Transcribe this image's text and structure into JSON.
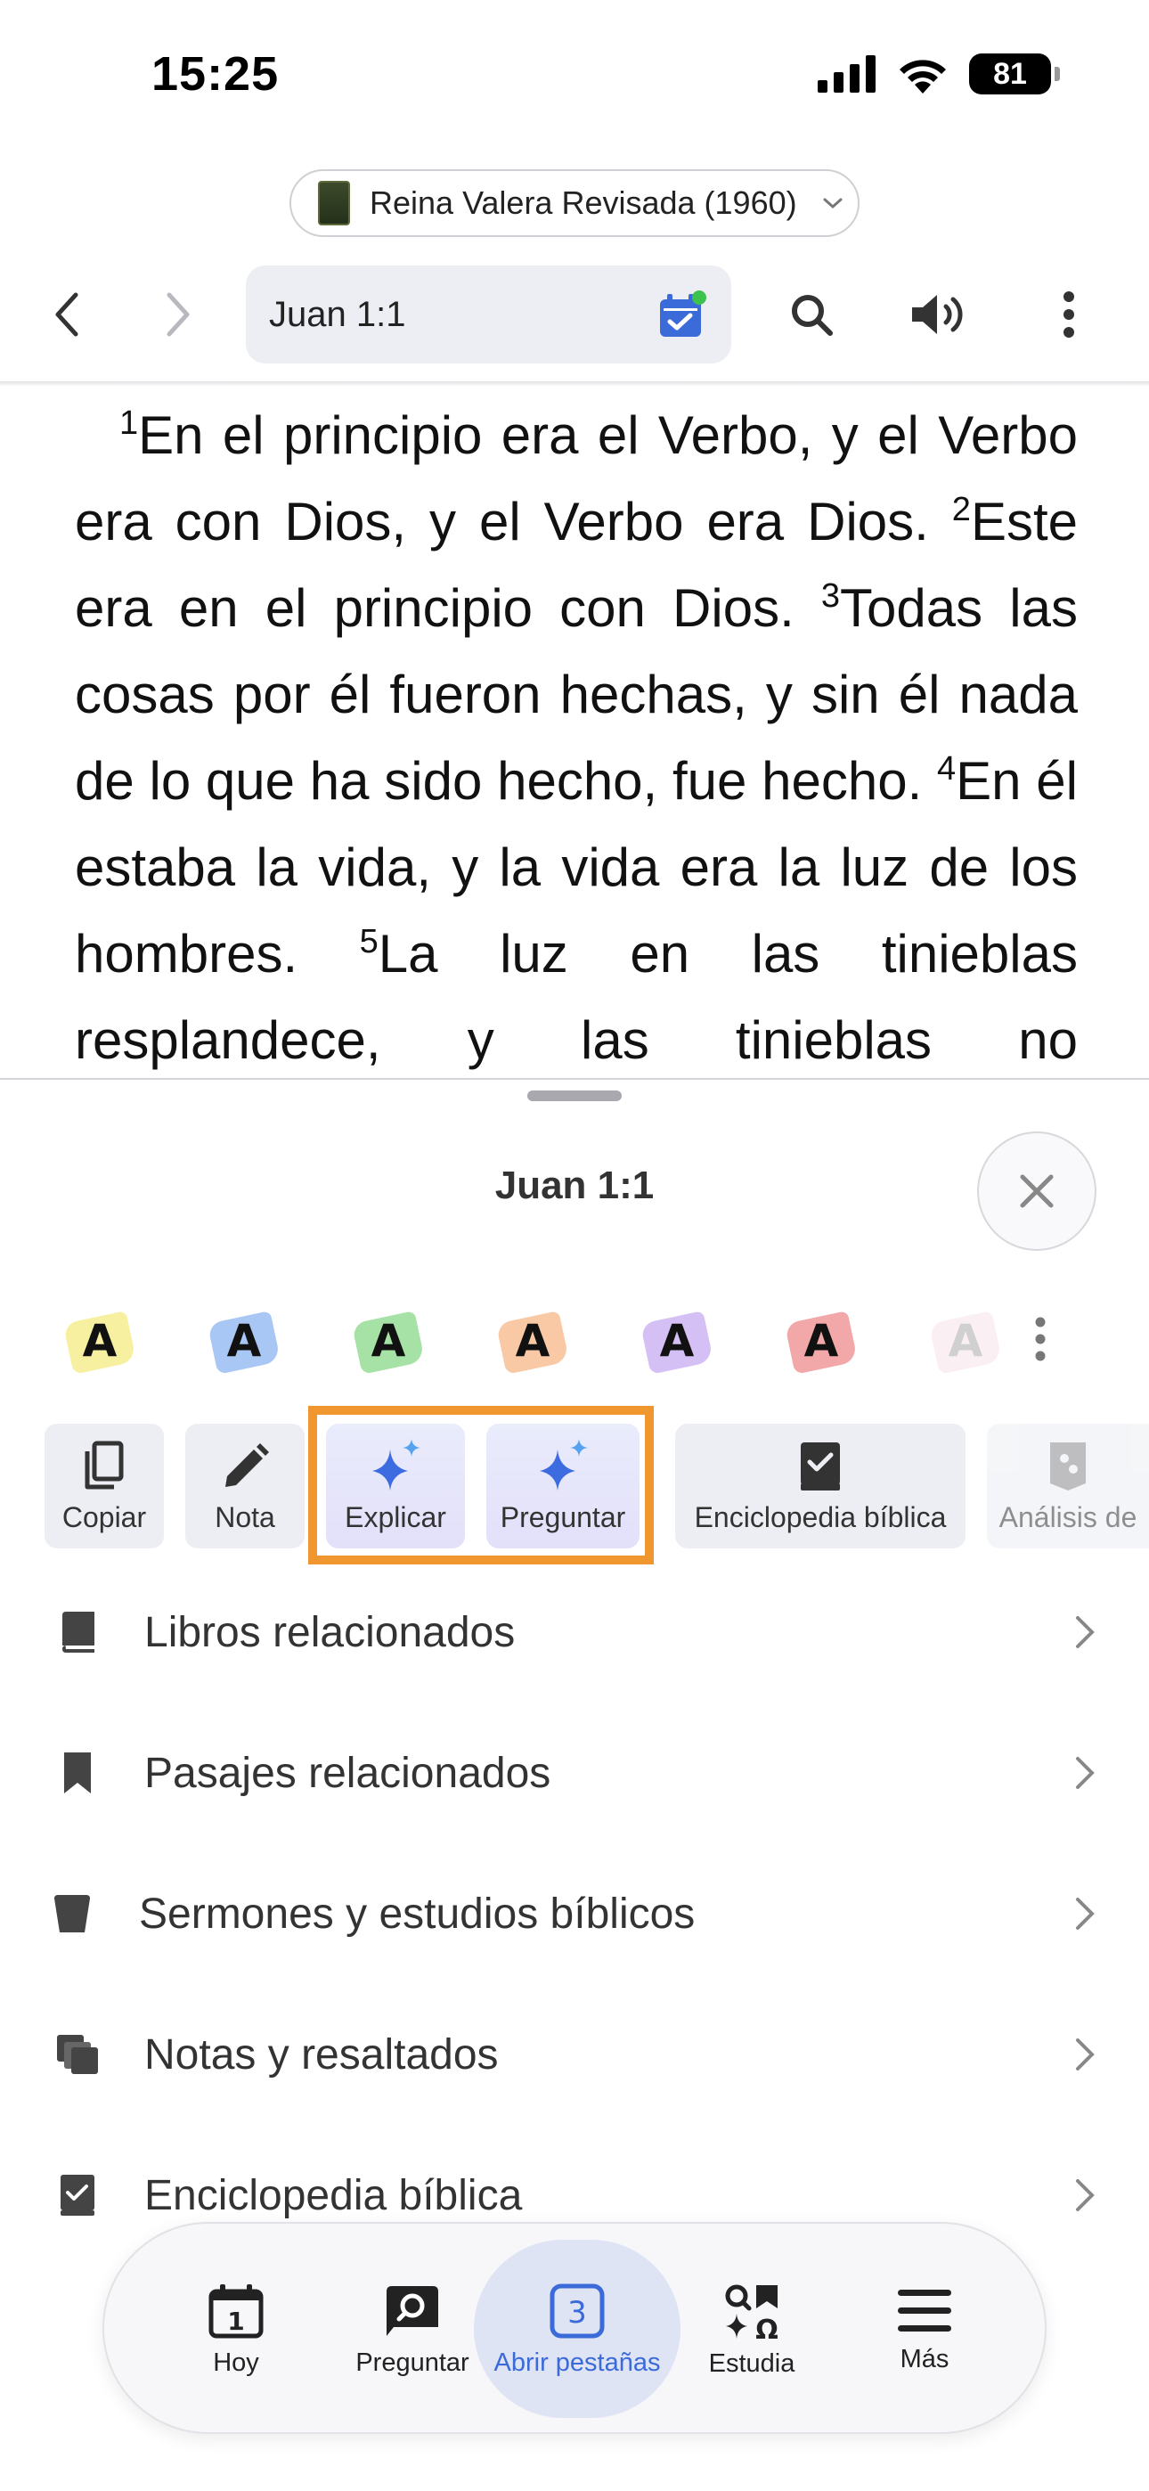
{
  "status_bar": {
    "time": "15:25",
    "battery": "81"
  },
  "version": {
    "label": "Reina Valera Revisada (1960)"
  },
  "nav": {
    "reference": "Juan 1:1"
  },
  "verses": [
    {
      "num": "1",
      "text": "En el principio era el Verbo, y el Verbo era con Dios, y el Verbo era Dios. "
    },
    {
      "num": "2",
      "text": "Este era en el principio con Dios. "
    },
    {
      "num": "3",
      "text": "Todas las cosas por él fueron hechas, y sin él nada de lo que ha sido hecho, fue hecho. "
    },
    {
      "num": "4",
      "text": "En él estaba la vida, y la vida era la luz de los hombres. "
    },
    {
      "num": "5",
      "text": "La luz en las tinieblas resplandece, y las tinieblas no prevalecieron contra ella."
    }
  ],
  "sheet": {
    "title": "Juan 1:1"
  },
  "highlights": {
    "letter": "A",
    "colors": [
      "#f7f0a0",
      "#a9c7f4",
      "#a6e2a6",
      "#f8c9a4",
      "#d4c0f4",
      "#f2a8a8",
      "#f6dce6"
    ]
  },
  "actions": {
    "copy": "Copiar",
    "note": "Nota",
    "explain": "Explicar",
    "ask": "Preguntar",
    "encyclopedia": "Enciclopedia bíblica",
    "analysis": "Análisis de"
  },
  "list": [
    {
      "icon": "book-icon",
      "label": "Libros relacionados"
    },
    {
      "icon": "bookmark-icon",
      "label": "Pasajes relacionados"
    },
    {
      "icon": "podium-icon",
      "label": "Sermones y estudios bíblicos"
    },
    {
      "icon": "notes-icon",
      "label": "Notas y resaltados"
    },
    {
      "icon": "encyclopedia-icon",
      "label": "Enciclopedia bíblica"
    }
  ],
  "tabs": {
    "today": "Hoy",
    "today_badge": "1",
    "ask": "Preguntar",
    "open_tabs": "Abrir pestañas",
    "open_tabs_count": "3",
    "study": "Estudia",
    "more": "Más"
  },
  "colors": {
    "accent": "#3b6ad9",
    "focus": "#f0962f"
  }
}
